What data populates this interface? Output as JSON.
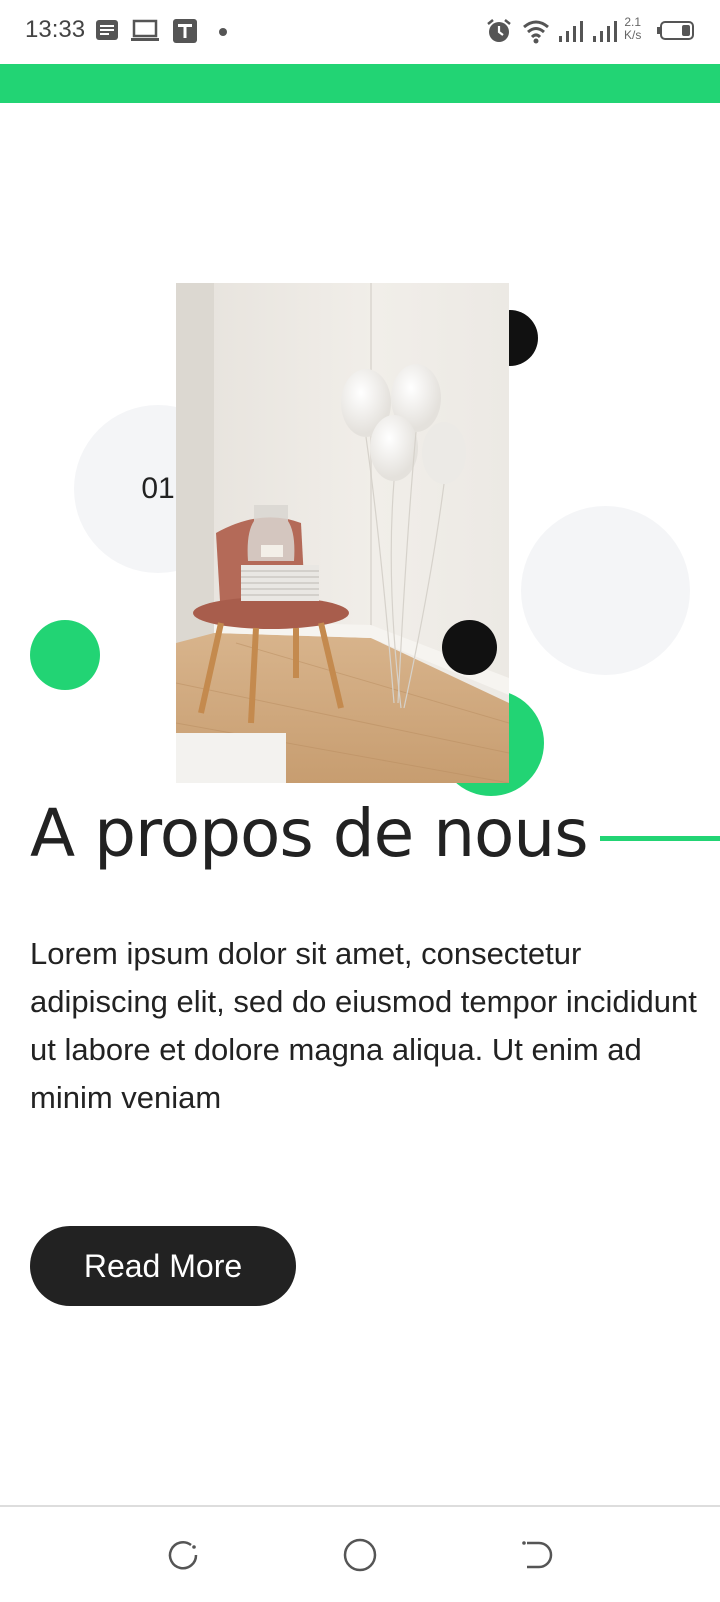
{
  "status_bar": {
    "time": "13:33",
    "net_speed_value": "2.1",
    "net_speed_unit": "K/s",
    "left_icons": [
      "notes-icon",
      "laptop-icon",
      "t-app-icon",
      "dot-icon"
    ],
    "right_icons": [
      "alarm-icon",
      "wifi-icon",
      "signal-icon",
      "signal-icon",
      "battery-icon"
    ]
  },
  "colors": {
    "accent": "#22d474",
    "dark": "#222222",
    "light_circle": "#f4f5f7"
  },
  "hero": {
    "number_badge": "01",
    "image_alt": "Pink chair with books and vase beside white balloons in a room corner"
  },
  "about": {
    "heading": "A propos de nous",
    "paragraph": "Lorem ipsum dolor sit amet, consectetur adipiscing elit, sed do eiusmod tempor incididunt ut labore et dolore magna aliqua. Ut enim ad minim veniam",
    "button_label": "Read More"
  },
  "nav_bar": {
    "buttons": [
      "recents-icon",
      "home-icon",
      "back-icon"
    ]
  }
}
